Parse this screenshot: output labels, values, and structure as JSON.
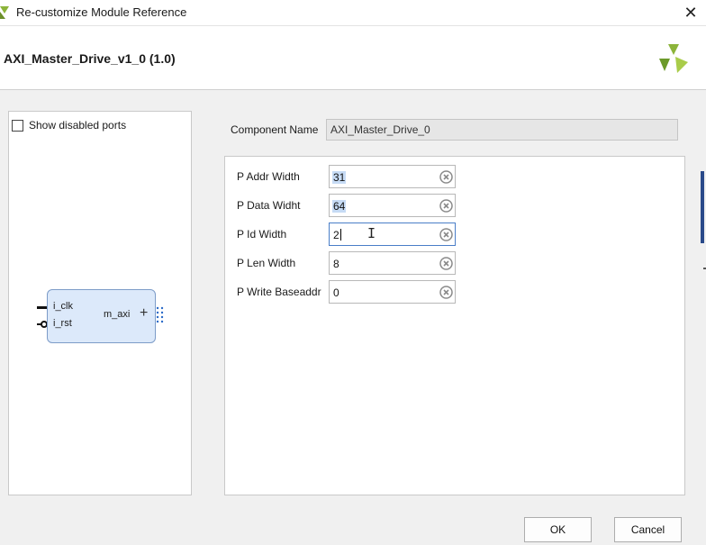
{
  "window": {
    "title": "Re-customize Module Reference",
    "close_icon": "close-icon"
  },
  "header": {
    "module_title": "AXI_Master_Drive_v1_0 (1.0)",
    "logo": "xilinx-logo"
  },
  "left_panel": {
    "show_disabled_ports_label": "Show disabled ports",
    "show_disabled_ports_checked": false,
    "block": {
      "port_clk": "i_clk",
      "port_rst": "i_rst",
      "port_maxi": "m_axi",
      "expand_icon": "plus-icon",
      "bus_icon": "bus-interface-icon"
    }
  },
  "component_name": {
    "label": "Component Name",
    "value": "AXI_Master_Drive_0"
  },
  "params": [
    {
      "label": "P Addr Width",
      "value": "31",
      "selected": true
    },
    {
      "label": "P Data Widht",
      "value": "64",
      "selected": true
    },
    {
      "label": "P Id Width",
      "value": "2",
      "focused": true
    },
    {
      "label": "P Len Width",
      "value": "8"
    },
    {
      "label": "P Write Baseaddr",
      "value": "0"
    }
  ],
  "buttons": {
    "ok": "OK",
    "cancel": "Cancel"
  },
  "colors": {
    "block_fill": "#dce9fa",
    "block_border": "#7d9cc8",
    "selection": "#c6dbf5",
    "focus_border": "#4a7ec8",
    "logo_green": "#8cb43a"
  }
}
